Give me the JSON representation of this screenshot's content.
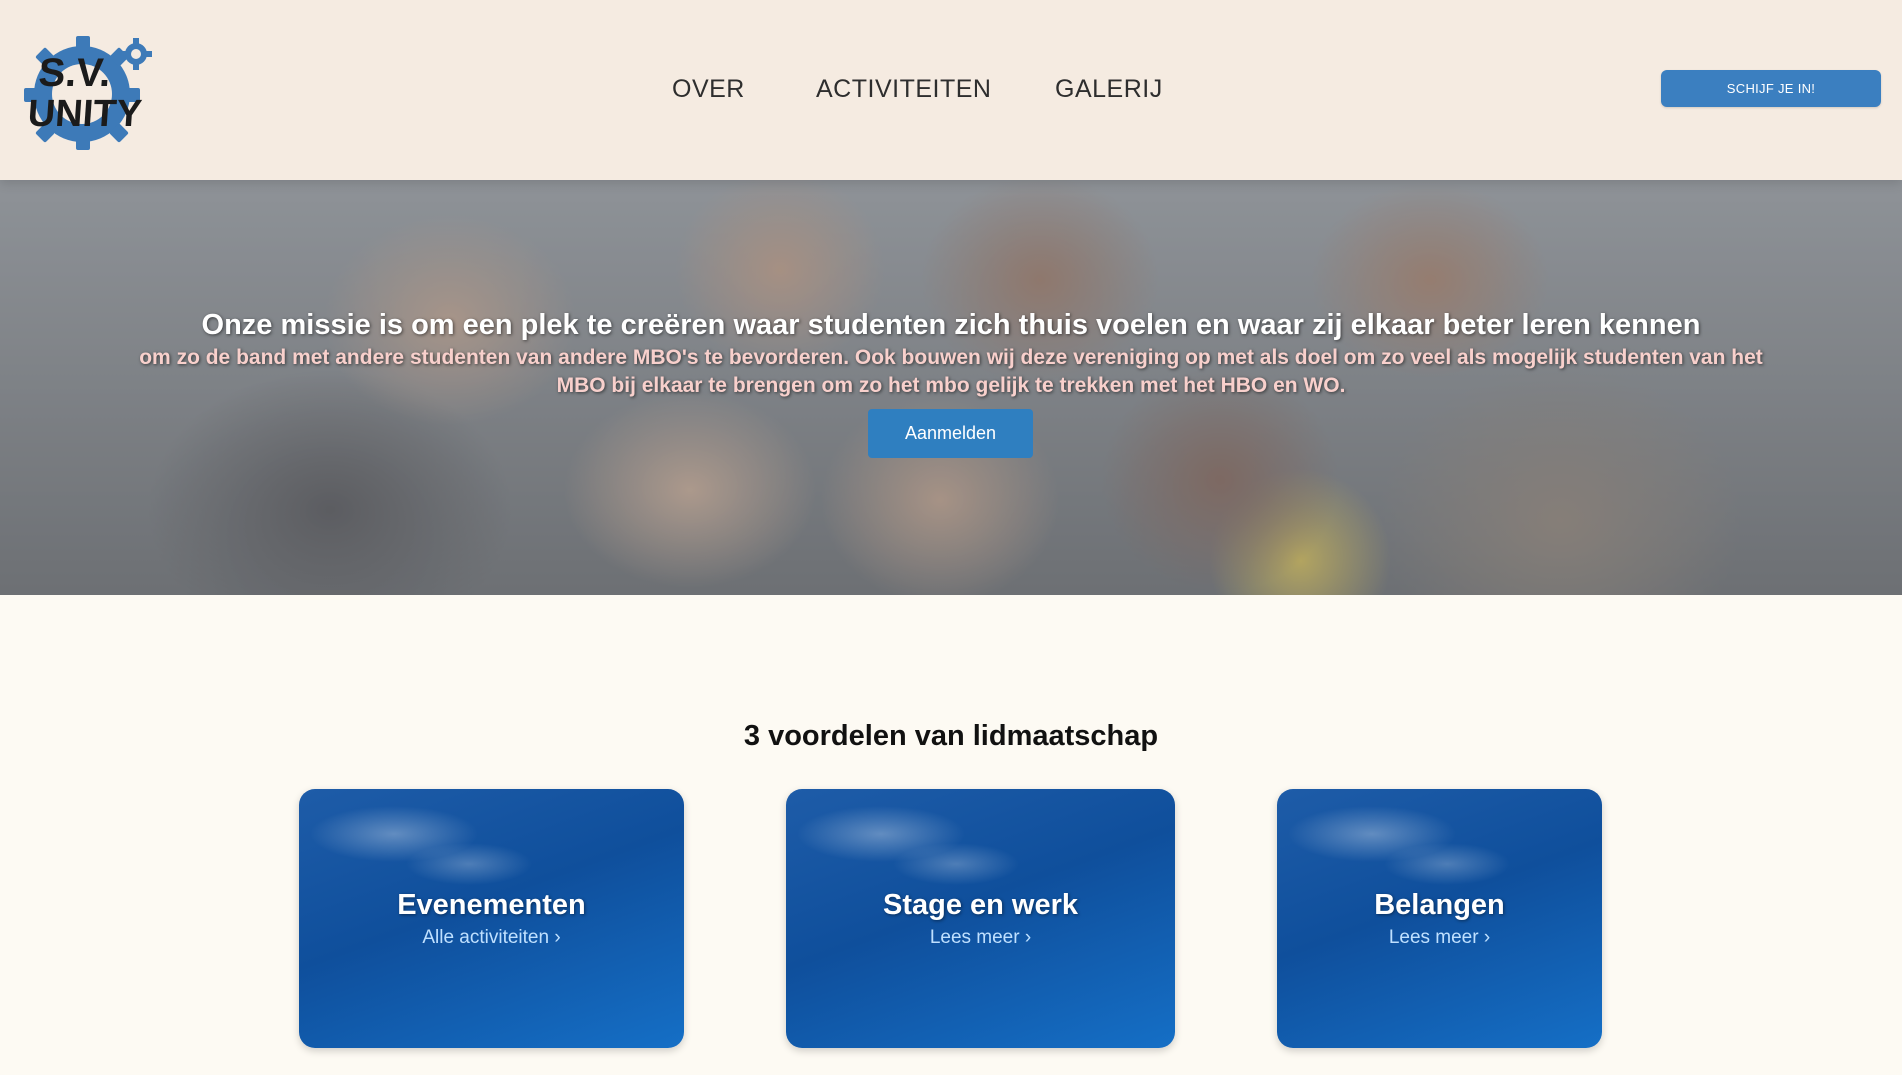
{
  "header": {
    "logo_text": "S.V. UNITY",
    "nav": [
      {
        "label": "OVER"
      },
      {
        "label": "ACTIVITEITEN"
      },
      {
        "label": "GALERIJ"
      }
    ],
    "cta_label": "SCHIJF JE IN!"
  },
  "hero": {
    "title": "Onze missie is om een plek te creëren waar studenten zich thuis voelen en waar zij elkaar beter leren kennen",
    "text": "om zo de band met andere studenten van andere MBO's te bevorderen. Ook bouwen wij deze vereniging op met als doel om zo veel als mogelijk studenten van het MBO bij elkaar te brengen om zo het mbo gelijk te trekken met het HBO en WO.",
    "button_label": "Aanmelden"
  },
  "benefits": {
    "title": "3 voordelen van lidmaatschap",
    "cards": [
      {
        "title": "Evenementen",
        "link": "Alle activiteiten ›"
      },
      {
        "title": "Stage en werk",
        "link": "Lees meer ›"
      },
      {
        "title": "Belangen",
        "link": "Lees meer ›"
      }
    ]
  },
  "colors": {
    "header_bg": "#f5ebe1",
    "page_bg": "#fdfaf3",
    "accent": "#3b7fc0",
    "card_blue": "#0f4f9c"
  }
}
